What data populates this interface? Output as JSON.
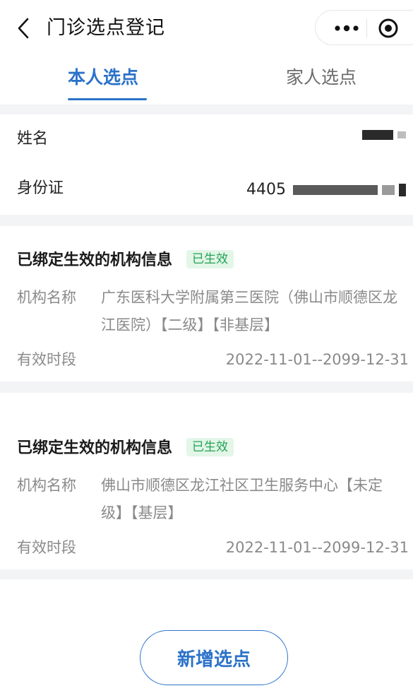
{
  "header": {
    "title": "门诊选点登记",
    "back_icon": "chevron-left-icon",
    "more_icon": "more-dots-icon",
    "target_icon": "target-circle-icon"
  },
  "tabs": [
    {
      "label": "本人选点",
      "active": true
    },
    {
      "label": "家人选点",
      "active": false
    }
  ],
  "identity": {
    "name_label": "姓名",
    "id_label": "身份证",
    "id_value_prefix": "4405"
  },
  "institutions": [
    {
      "title": "已绑定生效的机构信息",
      "badge": "已生效",
      "name_label": "机构名称",
      "name_value": "广东医科大学附属第三医院（佛山市顺德区龙江医院）【二级】【非基层】",
      "period_label": "有效时段",
      "period_value": "2022-11-01--2099-12-31"
    },
    {
      "title": "已绑定生效的机构信息",
      "badge": "已生效",
      "name_label": "机构名称",
      "name_value": "佛山市顺德区龙江社区卫生服务中心【未定级】【基层】",
      "period_label": "有效时段",
      "period_value": "2022-11-01--2099-12-31"
    }
  ],
  "actions": {
    "add_label": "新增选点"
  },
  "colors": {
    "accent": "#2b72c9",
    "badge_text": "#23a355",
    "badge_bg": "#e3f6e8",
    "gap": "#f3f4f6"
  }
}
